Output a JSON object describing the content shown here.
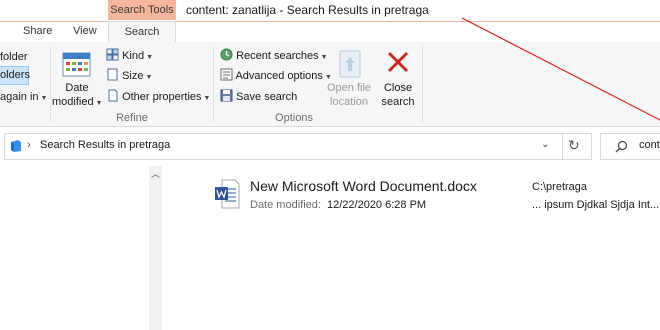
{
  "window": {
    "title": "content: zanatlija - Search Results in pretraga",
    "context_group": "Search Tools"
  },
  "tabs": [
    {
      "label": "Share"
    },
    {
      "label": "View"
    },
    {
      "label": "Search",
      "active": true
    }
  ],
  "ribbon": {
    "location": {
      "items": [
        "folder",
        "olders",
        "again in"
      ]
    },
    "refine": {
      "date_modified": {
        "line1": "Date",
        "line2": "modified"
      },
      "kind": "Kind",
      "size": "Size",
      "other_properties": "Other properties",
      "group_label": "Refine"
    },
    "options": {
      "recent_searches": "Recent searches",
      "advanced_options": "Advanced options",
      "save_search": "Save search",
      "open_file_location": {
        "line1": "Open file",
        "line2": "location"
      },
      "close_search": {
        "line1": "Close",
        "line2": "search"
      },
      "group_label": "Options"
    }
  },
  "address": {
    "path": "Search Results in pretraga",
    "search_value": "cont"
  },
  "results": [
    {
      "name": "New Microsoft Word Document.docx",
      "meta_label": "Date modified:",
      "meta_value": "12/22/2020 6:28 PM",
      "folder": "C:\\pretraga",
      "snippet": "... ipsum Djdkal Sjdja Int..."
    }
  ],
  "colors": {
    "context_tab": "#f5b69d",
    "selected": "#cce4f7",
    "close_x": "#c42b1c",
    "annotation_line": "#e02020"
  },
  "icons": [
    "calendar-icon",
    "kind-icon",
    "size-icon",
    "other-properties-icon",
    "recent-searches-icon",
    "advanced-options-icon",
    "save-search-icon",
    "open-file-location-icon",
    "close-search-icon",
    "library-icon",
    "chevron-right-icon",
    "chevron-down-icon",
    "refresh-icon",
    "search-icon",
    "scroll-up-icon",
    "word-document-icon"
  ]
}
